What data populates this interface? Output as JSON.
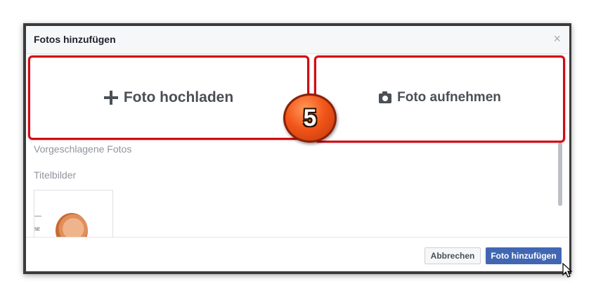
{
  "dialog": {
    "title": "Fotos hinzufügen",
    "close_symbol": "×"
  },
  "options": {
    "upload_label": "Foto hochladen",
    "upload_icon": "plus-icon",
    "camera_label": "Foto aufnehmen",
    "camera_icon": "camera-icon"
  },
  "sections": {
    "suggested": "Vorgeschlagene Fotos",
    "cover": "Titelbilder"
  },
  "thumbnail": {
    "tag_text": "SE"
  },
  "footer": {
    "cancel_label": "Abbrechen",
    "submit_label": "Foto hinzufügen"
  },
  "annotation": {
    "step_number": "5",
    "highlight_color": "#d10a14"
  },
  "colors": {
    "primary": "#4267b2",
    "text": "#4b4f56"
  }
}
